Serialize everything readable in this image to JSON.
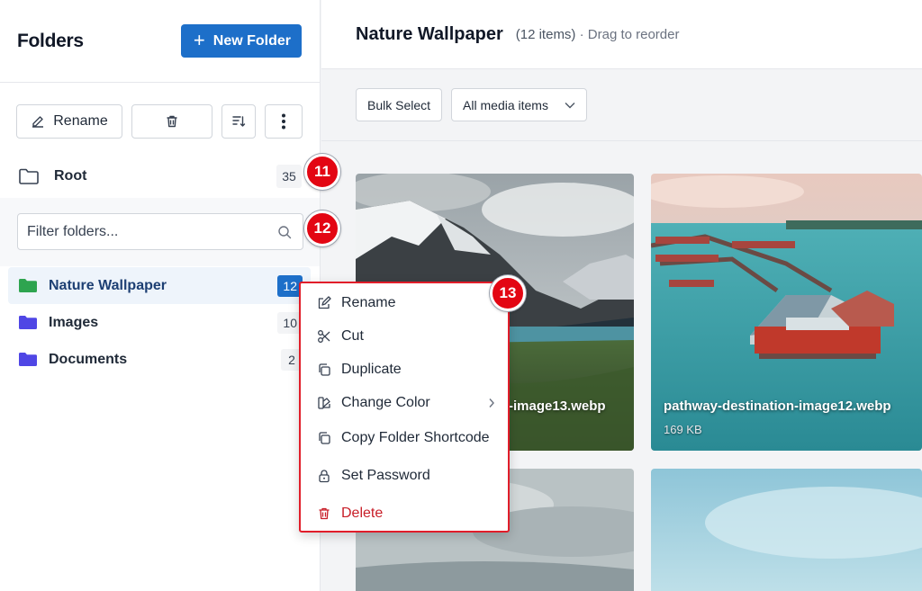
{
  "sidebar": {
    "title": "Folders",
    "new_folder_label": "New Folder",
    "toolbar": {
      "rename_label": "Rename"
    },
    "root": {
      "label": "Root",
      "count": "35"
    },
    "filter": {
      "placeholder": "Filter folders..."
    },
    "folders": [
      {
        "label": "Nature Wallpaper",
        "count": "12",
        "color": "#2ea44f",
        "active": true
      },
      {
        "label": "Images",
        "count": "10",
        "color": "#4f46e5",
        "active": false
      },
      {
        "label": "Documents",
        "count": "2",
        "color": "#4f46e5",
        "active": false
      }
    ]
  },
  "main": {
    "title": "Nature Wallpaper",
    "item_count": "(12 items)",
    "hint": "· Drag to reorder",
    "bulk_select_label": "Bulk Select",
    "media_filter_value": "All media items",
    "cards": [
      {
        "name": "-image13.webp"
      },
      {
        "name": "pathway-destination-image12.webp",
        "size": "169 KB"
      }
    ]
  },
  "context_menu": {
    "items": [
      {
        "label": "Rename",
        "icon": "pencil-icon"
      },
      {
        "label": "Cut",
        "icon": "scissors-icon"
      },
      {
        "label": "Duplicate",
        "icon": "copy-icon"
      },
      {
        "label": "Change Color",
        "icon": "palette-icon"
      },
      {
        "label": "Copy Folder Shortcode",
        "icon": "copy-icon"
      },
      {
        "label": "Set Password",
        "icon": "lock-icon"
      },
      {
        "label": "Delete",
        "icon": "trash-icon"
      }
    ]
  },
  "markers": {
    "m11": "11",
    "m12": "12",
    "m13": "13"
  },
  "colors": {
    "accent": "#1d6fc9",
    "danger": "#e11d2a",
    "folder_green": "#2ea44f",
    "folder_indigo": "#4f46e5"
  }
}
